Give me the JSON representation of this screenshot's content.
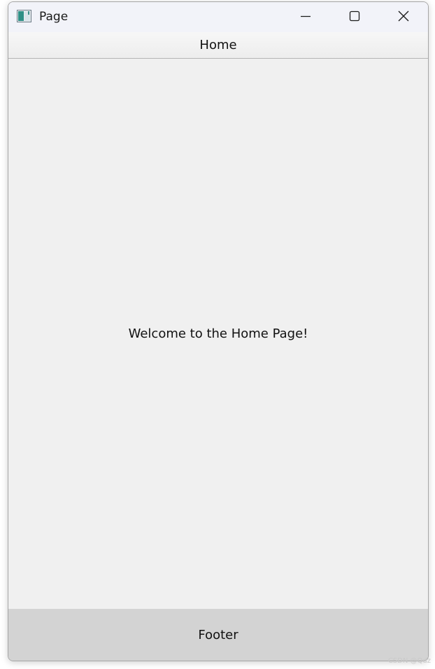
{
  "window": {
    "title": "Page",
    "icon": "app-window-icon",
    "controls": {
      "minimize": "minimize-icon",
      "maximize": "maximize-icon",
      "close": "close-icon"
    }
  },
  "header": {
    "title": "Home"
  },
  "main": {
    "message": "Welcome to the Home Page!"
  },
  "footer": {
    "text": "Footer"
  },
  "watermark": {
    "text": "CSDN @Qdz"
  },
  "colors": {
    "titlebar": "#f2f3f9",
    "content": "#f0f0f0",
    "footer": "#d3d3d3",
    "border": "#a6a6a6"
  }
}
